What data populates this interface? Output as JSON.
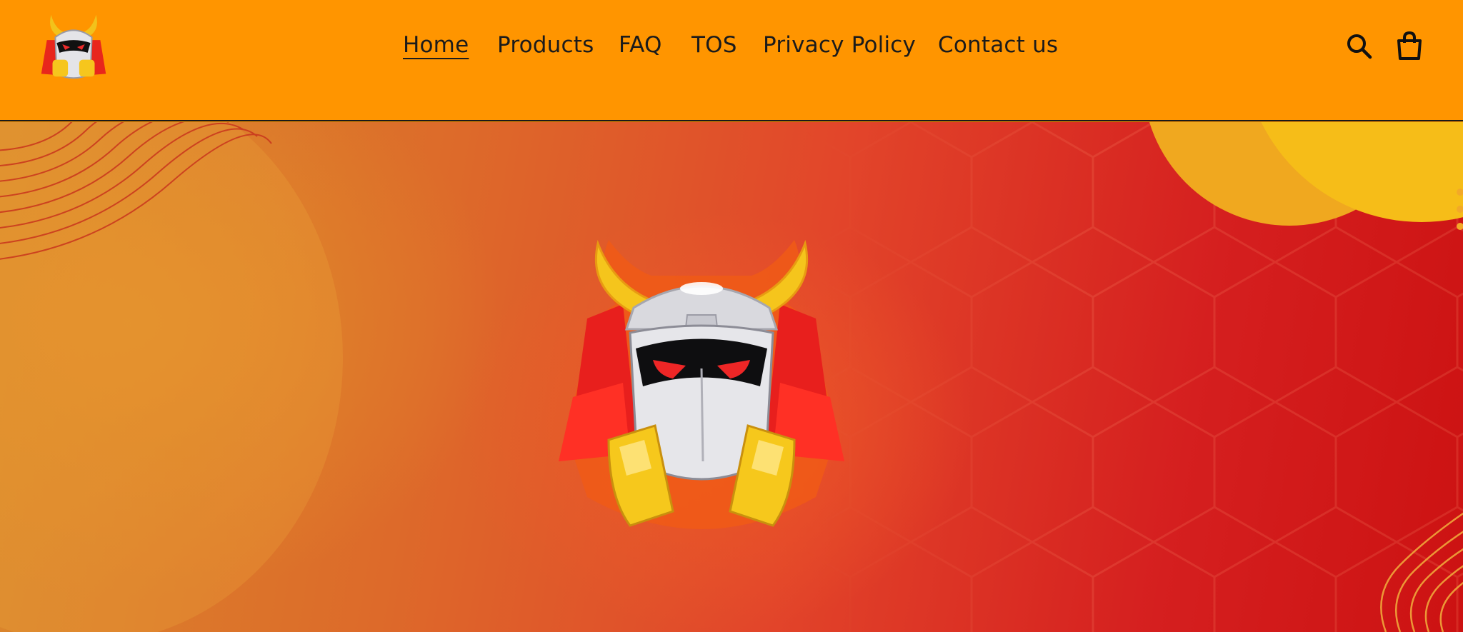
{
  "header": {
    "logo_alt": "",
    "nav": [
      {
        "label": "Home",
        "active": true
      },
      {
        "label": "Products",
        "active": false
      },
      {
        "label": "FAQ",
        "active": false
      },
      {
        "label": "TOS",
        "active": false
      },
      {
        "label": "Privacy Policy",
        "active": false
      },
      {
        "label": "Contact us",
        "active": false
      }
    ],
    "icons": {
      "search": "search-icon",
      "cart": "cart-icon"
    }
  },
  "hero": {
    "image": "samurai-gas-mask-mascot"
  },
  "colors": {
    "header_bg": "#ff9500",
    "accent_red": "#d51f1f",
    "accent_yellow": "#f5bd1a"
  }
}
